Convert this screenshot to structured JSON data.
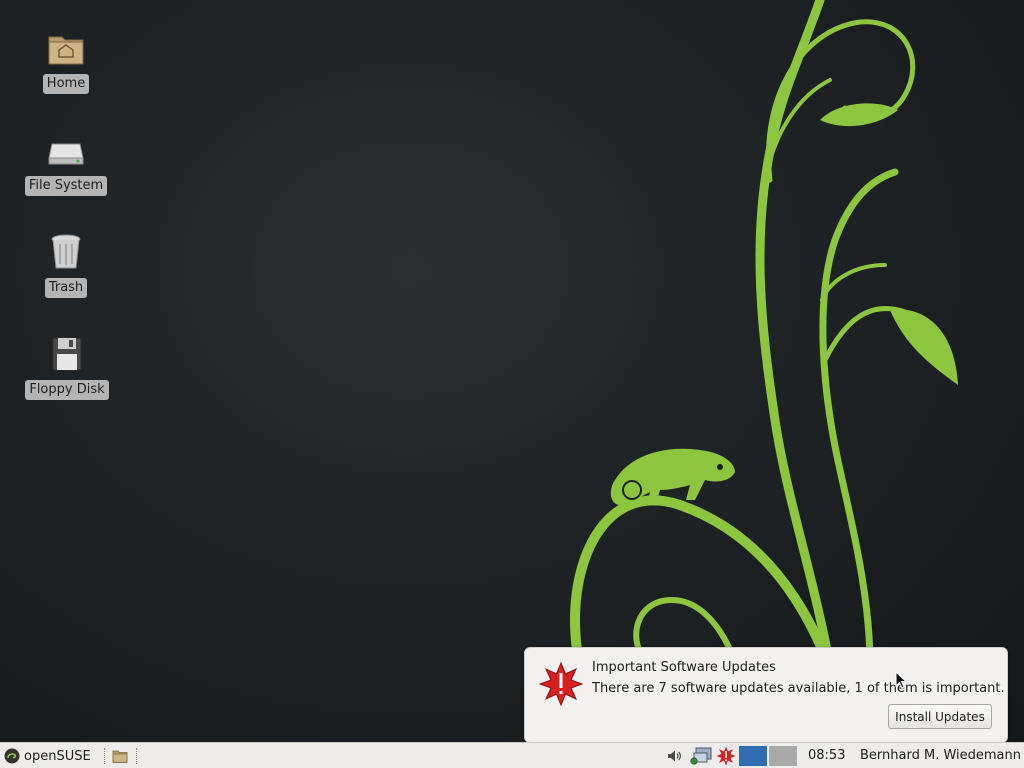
{
  "desktop": {
    "icons": [
      {
        "label": "Home",
        "icon": "home-folder-icon"
      },
      {
        "label": "File System",
        "icon": "hard-drive-icon"
      },
      {
        "label": "Trash",
        "icon": "trash-icon"
      },
      {
        "label": "Floppy Disk",
        "icon": "floppy-disk-icon"
      }
    ],
    "wallpaper": {
      "accent": "#8cc63e",
      "background": "#1d2022",
      "motif": "chameleon-vine"
    }
  },
  "notification": {
    "title": "Important Software Updates",
    "body": "There are 7 software updates available, 1 of them is important.",
    "button_label": "Install Updates",
    "icon": "warning-star-icon",
    "icon_color": "#d7201f"
  },
  "taskbar": {
    "start_label": "openSUSE",
    "start_icon": "opensuse-logo-icon",
    "launcher_icon": "folder-icon",
    "tray": [
      "volume-icon",
      "network-icon",
      "update-alert-icon"
    ],
    "workspaces": [
      {
        "name": "workspace-1",
        "active": true,
        "color": "#2f6cb0"
      },
      {
        "name": "workspace-2",
        "active": false,
        "color": "#a9a9a9"
      }
    ],
    "clock": "08:53",
    "user": "Bernhard M. Wiedemann"
  }
}
